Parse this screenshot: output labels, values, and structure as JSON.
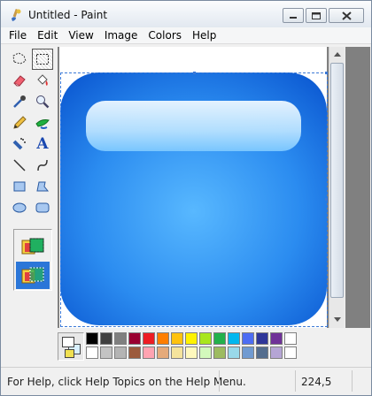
{
  "window": {
    "title": "Untitled - Paint"
  },
  "menu": [
    {
      "label": "File"
    },
    {
      "label": "Edit"
    },
    {
      "label": "View"
    },
    {
      "label": "Image"
    },
    {
      "label": "Colors"
    },
    {
      "label": "Help"
    }
  ],
  "tools": [
    {
      "icon": "free-form-select-icon"
    },
    {
      "icon": "rect-select-icon",
      "selected": true
    },
    {
      "icon": "eraser-icon"
    },
    {
      "icon": "fill-icon"
    },
    {
      "icon": "pick-color-icon"
    },
    {
      "icon": "magnifier-icon"
    },
    {
      "icon": "pencil-icon"
    },
    {
      "icon": "brush-icon"
    },
    {
      "icon": "airbrush-icon"
    },
    {
      "icon": "text-icon"
    },
    {
      "icon": "line-icon"
    },
    {
      "icon": "curve-icon"
    },
    {
      "icon": "rectangle-icon"
    },
    {
      "icon": "polygon-icon"
    },
    {
      "icon": "ellipse-icon"
    },
    {
      "icon": "rounded-rectangle-icon"
    }
  ],
  "text_tool_glyph": "A",
  "tool_options": [
    {
      "icon": "opaque-selection-icon",
      "selected": false
    },
    {
      "icon": "transparent-selection-icon",
      "selected": true
    }
  ],
  "palette": {
    "foreground": "#ffffff",
    "background": "#d8f0ff",
    "colors": [
      "#000000",
      "#404040",
      "#7f7f7f",
      "#990030",
      "#ed1c24",
      "#ff7e00",
      "#ffc20e",
      "#fff200",
      "#a8e61d",
      "#22b14c",
      "#00b7ef",
      "#4d6df3",
      "#2f3699",
      "#6f3198",
      "#ffffff",
      "#ffffff",
      "#c3c3c3",
      "#b4b4b4",
      "#9c5a3c",
      "#ffa3b1",
      "#e5aa7a",
      "#f5e49c",
      "#fff9bd",
      "#d3f9bc",
      "#9dbb61",
      "#99d9ea",
      "#709ad1",
      "#546d8e",
      "#b5a5d5",
      "#ffffff"
    ]
  },
  "status": {
    "help_text": "For Help, click Help Topics on the Help Menu.",
    "coordinates": "224,5"
  },
  "colors": {
    "selection_accent": "#2b76d8",
    "icon_blue_dark": "#0a5ed8",
    "icon_blue_light": "#52b2ff"
  }
}
